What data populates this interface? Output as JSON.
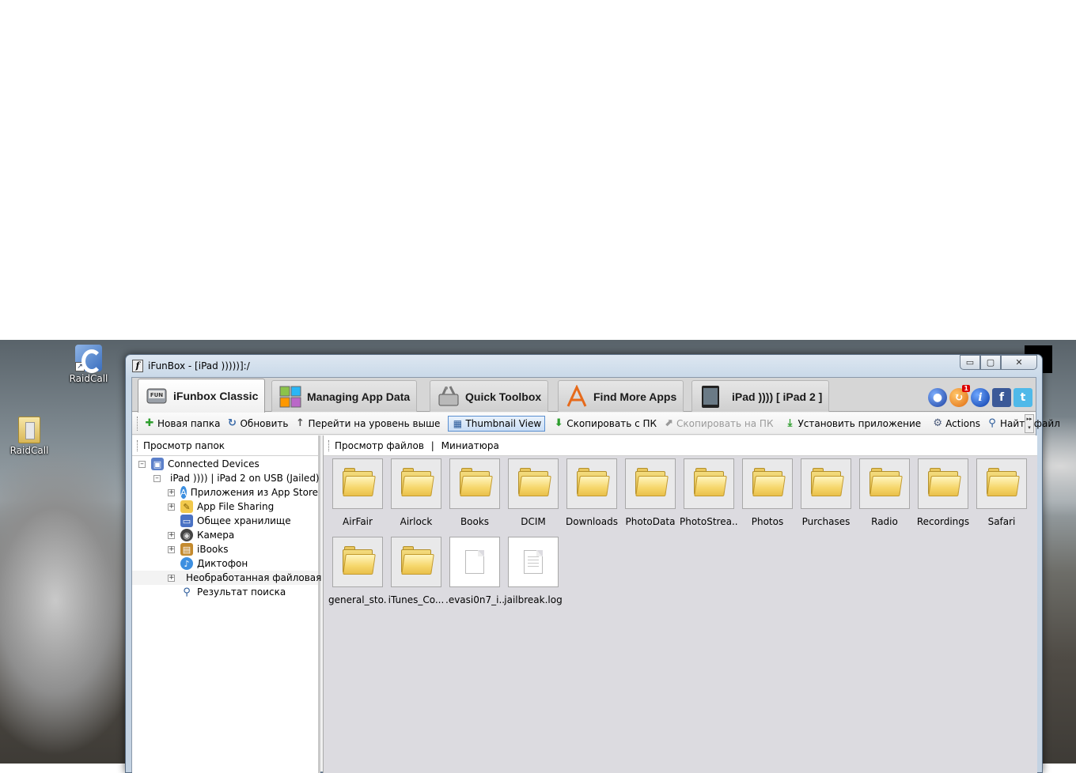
{
  "desktop": {
    "icons": [
      {
        "label": "RaidCall"
      },
      {
        "label": "RaidCall"
      }
    ]
  },
  "window": {
    "title": "iFunBox - [iPad )))))]:/",
    "buttons": {
      "minimize": "▭",
      "maximize": "▢",
      "close": "✕"
    }
  },
  "tabs": [
    {
      "label": "iFunbox Classic",
      "active": true
    },
    {
      "label": "Managing App Data"
    },
    {
      "label": "Quick Toolbox"
    },
    {
      "label": "Find More Apps"
    },
    {
      "label": "iPad )))) [ iPad 2 ]"
    }
  ],
  "social": {
    "badge": "1"
  },
  "toolbar": {
    "new_folder": "Новая папка",
    "refresh": "Обновить",
    "go_up": "Перейти на уровень выше",
    "thumbnail_view": "Thumbnail View",
    "copy_from_pc": "Скопировать с ПК",
    "copy_to_pc": "Скопировать на ПК",
    "install_app": "Установить приложение",
    "actions": "Actions",
    "find_file": "Найти файл"
  },
  "left_pane": {
    "header": "Просмотр папок",
    "tree": [
      {
        "label": "Connected Devices"
      },
      {
        "label": "iPad )))) | iPad 2 on USB (Jailed)"
      },
      {
        "label": "Приложения из App Store"
      },
      {
        "label": "App File Sharing"
      },
      {
        "label": "Общее хранилище"
      },
      {
        "label": "Камера"
      },
      {
        "label": "iBooks"
      },
      {
        "label": "Диктофон"
      },
      {
        "label": "Необработанная файловая"
      },
      {
        "label": "Результат поиска"
      }
    ]
  },
  "right_pane": {
    "header_left": "Просмотр файлов",
    "header_sep": "|",
    "header_right": "Миниатюра",
    "files": [
      {
        "name": "AirFair",
        "type": "folder"
      },
      {
        "name": "Airlock",
        "type": "folder"
      },
      {
        "name": "Books",
        "type": "folder"
      },
      {
        "name": "DCIM",
        "type": "folder"
      },
      {
        "name": "Downloads",
        "type": "folder"
      },
      {
        "name": "PhotoData",
        "type": "folder"
      },
      {
        "name": "PhotoStrea...",
        "type": "folder"
      },
      {
        "name": "Photos",
        "type": "folder"
      },
      {
        "name": "Purchases",
        "type": "folder"
      },
      {
        "name": "Radio",
        "type": "folder"
      },
      {
        "name": "Recordings",
        "type": "folder"
      },
      {
        "name": "Safari",
        "type": "folder"
      },
      {
        "name": "general_sto...",
        "type": "folder"
      },
      {
        "name": "iTunes_Co...",
        "type": "folder"
      },
      {
        "name": ".evasi0n7_i...",
        "type": "file"
      },
      {
        "name": "jailbreak.log",
        "type": "text-file"
      }
    ]
  }
}
